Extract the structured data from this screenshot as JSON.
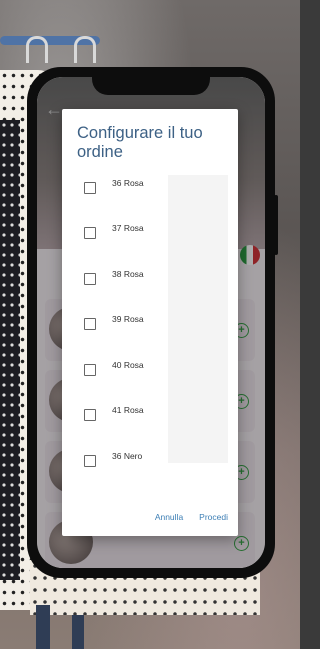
{
  "dialog": {
    "title": "Configurare il tuo ordine",
    "options": [
      {
        "label": "36 Rosa",
        "checked": false
      },
      {
        "label": "37 Rosa",
        "checked": false
      },
      {
        "label": "38 Rosa",
        "checked": false
      },
      {
        "label": "39 Rosa",
        "checked": false
      },
      {
        "label": "40 Rosa",
        "checked": false
      },
      {
        "label": "41 Rosa",
        "checked": false
      },
      {
        "label": "36 Nero",
        "checked": false
      }
    ],
    "cancel_label": "Annulla",
    "proceed_label": "Procedi"
  },
  "background_app": {
    "back_icon": "arrow-left-icon",
    "add_icon": "plus-circle-icon",
    "flag_icon": "italy-flag-icon"
  },
  "colors": {
    "title": "#3d6185",
    "action": "#3d7fb5",
    "add": "#3aa34a"
  }
}
